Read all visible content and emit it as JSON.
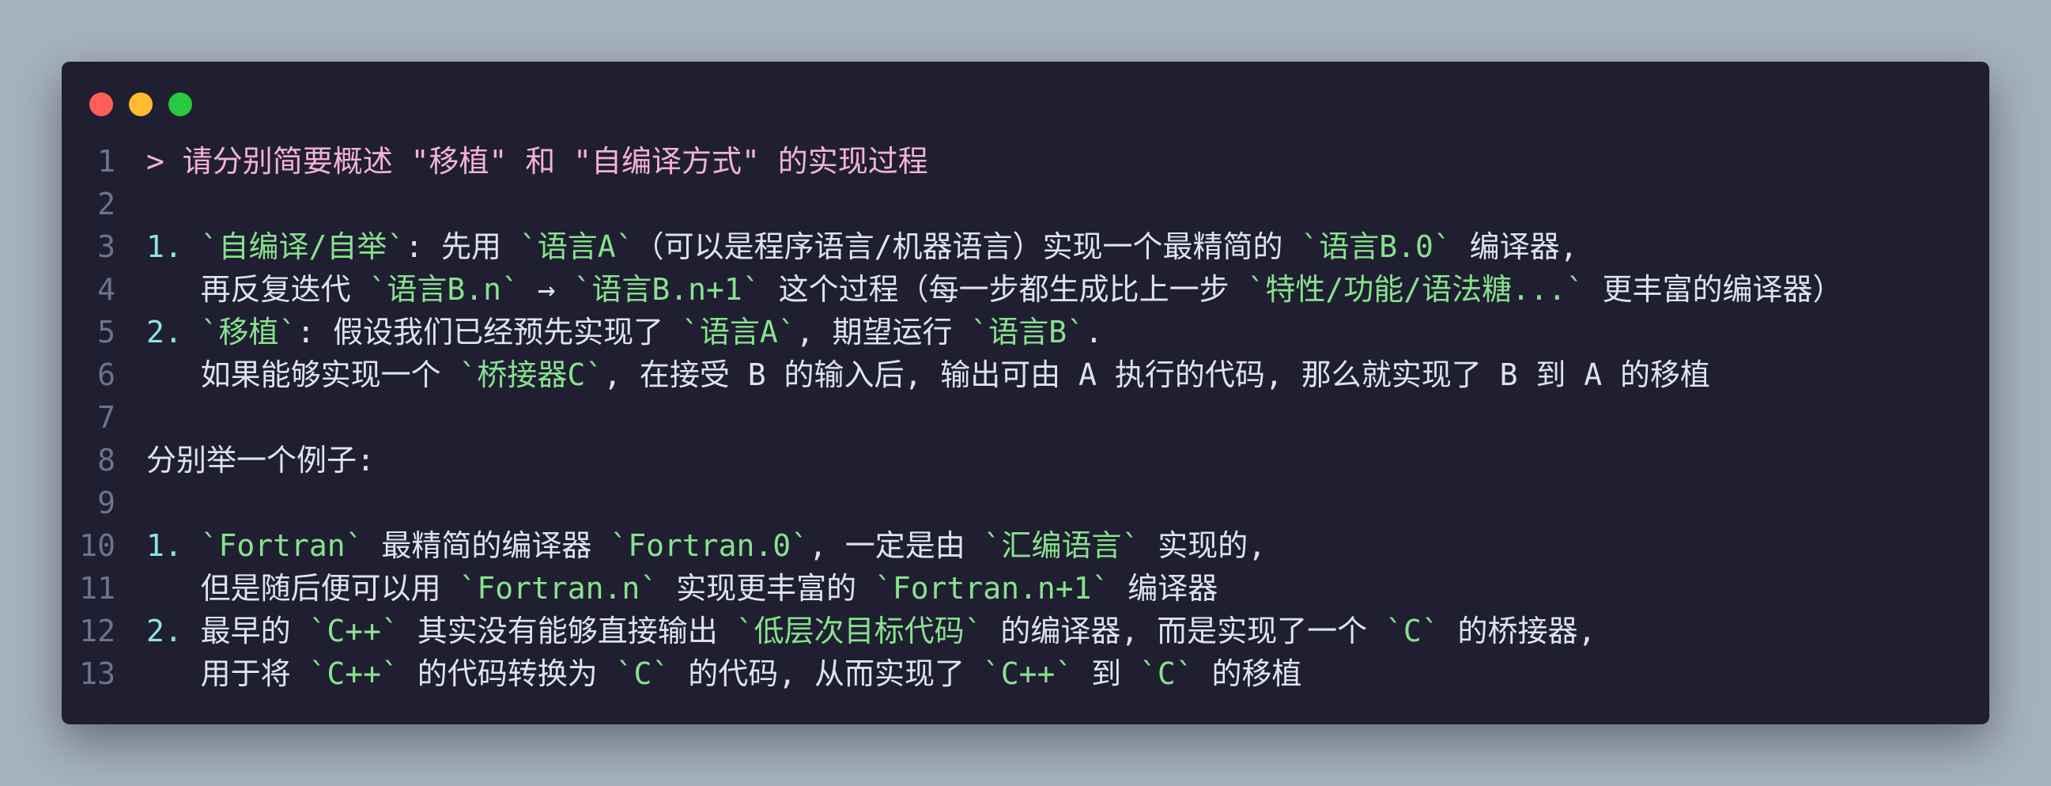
{
  "window": {
    "controls": [
      "close",
      "minimize",
      "maximize"
    ]
  },
  "lines": [
    {
      "number": "1",
      "segments": [
        {
          "text": "> 请分别简要概述 \"移植\" 和 \"自编译方式\" 的实现过程",
          "style": "pink"
        }
      ]
    },
    {
      "number": "2",
      "segments": []
    },
    {
      "number": "3",
      "segments": [
        {
          "text": "1. ",
          "style": "teal"
        },
        {
          "text": "`自编译/自举`",
          "style": "green"
        },
        {
          "text": ": 先用 ",
          "style": "plain"
        },
        {
          "text": "`语言A`",
          "style": "green"
        },
        {
          "text": "（可以是程序语言/机器语言）实现一个最精简的 ",
          "style": "plain"
        },
        {
          "text": "`语言B.0`",
          "style": "green"
        },
        {
          "text": " 编译器,",
          "style": "plain"
        }
      ]
    },
    {
      "number": "4",
      "segments": [
        {
          "text": "   再反复迭代 ",
          "style": "plain"
        },
        {
          "text": "`语言B.n`",
          "style": "green"
        },
        {
          "text": " → ",
          "style": "plain"
        },
        {
          "text": "`语言B.n+1`",
          "style": "green"
        },
        {
          "text": " 这个过程（每一步都生成比上一步 ",
          "style": "plain"
        },
        {
          "text": "`特性/功能/语法糖...`",
          "style": "green"
        },
        {
          "text": " 更丰富的编译器）",
          "style": "plain"
        }
      ]
    },
    {
      "number": "5",
      "segments": [
        {
          "text": "2. ",
          "style": "teal"
        },
        {
          "text": "`移植`",
          "style": "green"
        },
        {
          "text": ": 假设我们已经预先实现了 ",
          "style": "plain"
        },
        {
          "text": "`语言A`",
          "style": "green"
        },
        {
          "text": ", 期望运行 ",
          "style": "plain"
        },
        {
          "text": "`语言B`",
          "style": "green"
        },
        {
          "text": ".",
          "style": "plain"
        }
      ]
    },
    {
      "number": "6",
      "segments": [
        {
          "text": "   如果能够实现一个 ",
          "style": "plain"
        },
        {
          "text": "`桥接器C`",
          "style": "green"
        },
        {
          "text": ", 在接受 B 的输入后, 输出可由 A 执行的代码, 那么就实现了 B 到 A 的移植",
          "style": "plain"
        }
      ]
    },
    {
      "number": "7",
      "segments": []
    },
    {
      "number": "8",
      "segments": [
        {
          "text": "分别举一个例子:",
          "style": "plain"
        }
      ]
    },
    {
      "number": "9",
      "segments": []
    },
    {
      "number": "10",
      "segments": [
        {
          "text": "1. ",
          "style": "teal"
        },
        {
          "text": "`Fortran`",
          "style": "green"
        },
        {
          "text": " 最精简的编译器 ",
          "style": "plain"
        },
        {
          "text": "`Fortran.0`",
          "style": "green"
        },
        {
          "text": ", 一定是由 ",
          "style": "plain"
        },
        {
          "text": "`汇编语言`",
          "style": "green"
        },
        {
          "text": " 实现的,",
          "style": "plain"
        }
      ]
    },
    {
      "number": "11",
      "segments": [
        {
          "text": "   但是随后便可以用 ",
          "style": "plain"
        },
        {
          "text": "`Fortran.n`",
          "style": "green"
        },
        {
          "text": " 实现更丰富的 ",
          "style": "plain"
        },
        {
          "text": "`Fortran.n+1`",
          "style": "green"
        },
        {
          "text": " 编译器",
          "style": "plain"
        }
      ]
    },
    {
      "number": "12",
      "segments": [
        {
          "text": "2. ",
          "style": "teal"
        },
        {
          "text": "最早的 ",
          "style": "plain"
        },
        {
          "text": "`C++`",
          "style": "green"
        },
        {
          "text": " 其实没有能够直接输出 ",
          "style": "plain"
        },
        {
          "text": "`低层次目标代码`",
          "style": "green"
        },
        {
          "text": " 的编译器, 而是实现了一个 ",
          "style": "plain"
        },
        {
          "text": "`C`",
          "style": "green"
        },
        {
          "text": " 的桥接器,",
          "style": "plain"
        }
      ]
    },
    {
      "number": "13",
      "segments": [
        {
          "text": "   用于将 ",
          "style": "plain"
        },
        {
          "text": "`C++`",
          "style": "green"
        },
        {
          "text": " 的代码转换为 ",
          "style": "plain"
        },
        {
          "text": "`C`",
          "style": "green"
        },
        {
          "text": " 的代码, 从而实现了 ",
          "style": "plain"
        },
        {
          "text": "`C++`",
          "style": "green"
        },
        {
          "text": " 到 ",
          "style": "plain"
        },
        {
          "text": "`C`",
          "style": "green"
        },
        {
          "text": " 的移植",
          "style": "plain"
        }
      ]
    }
  ]
}
